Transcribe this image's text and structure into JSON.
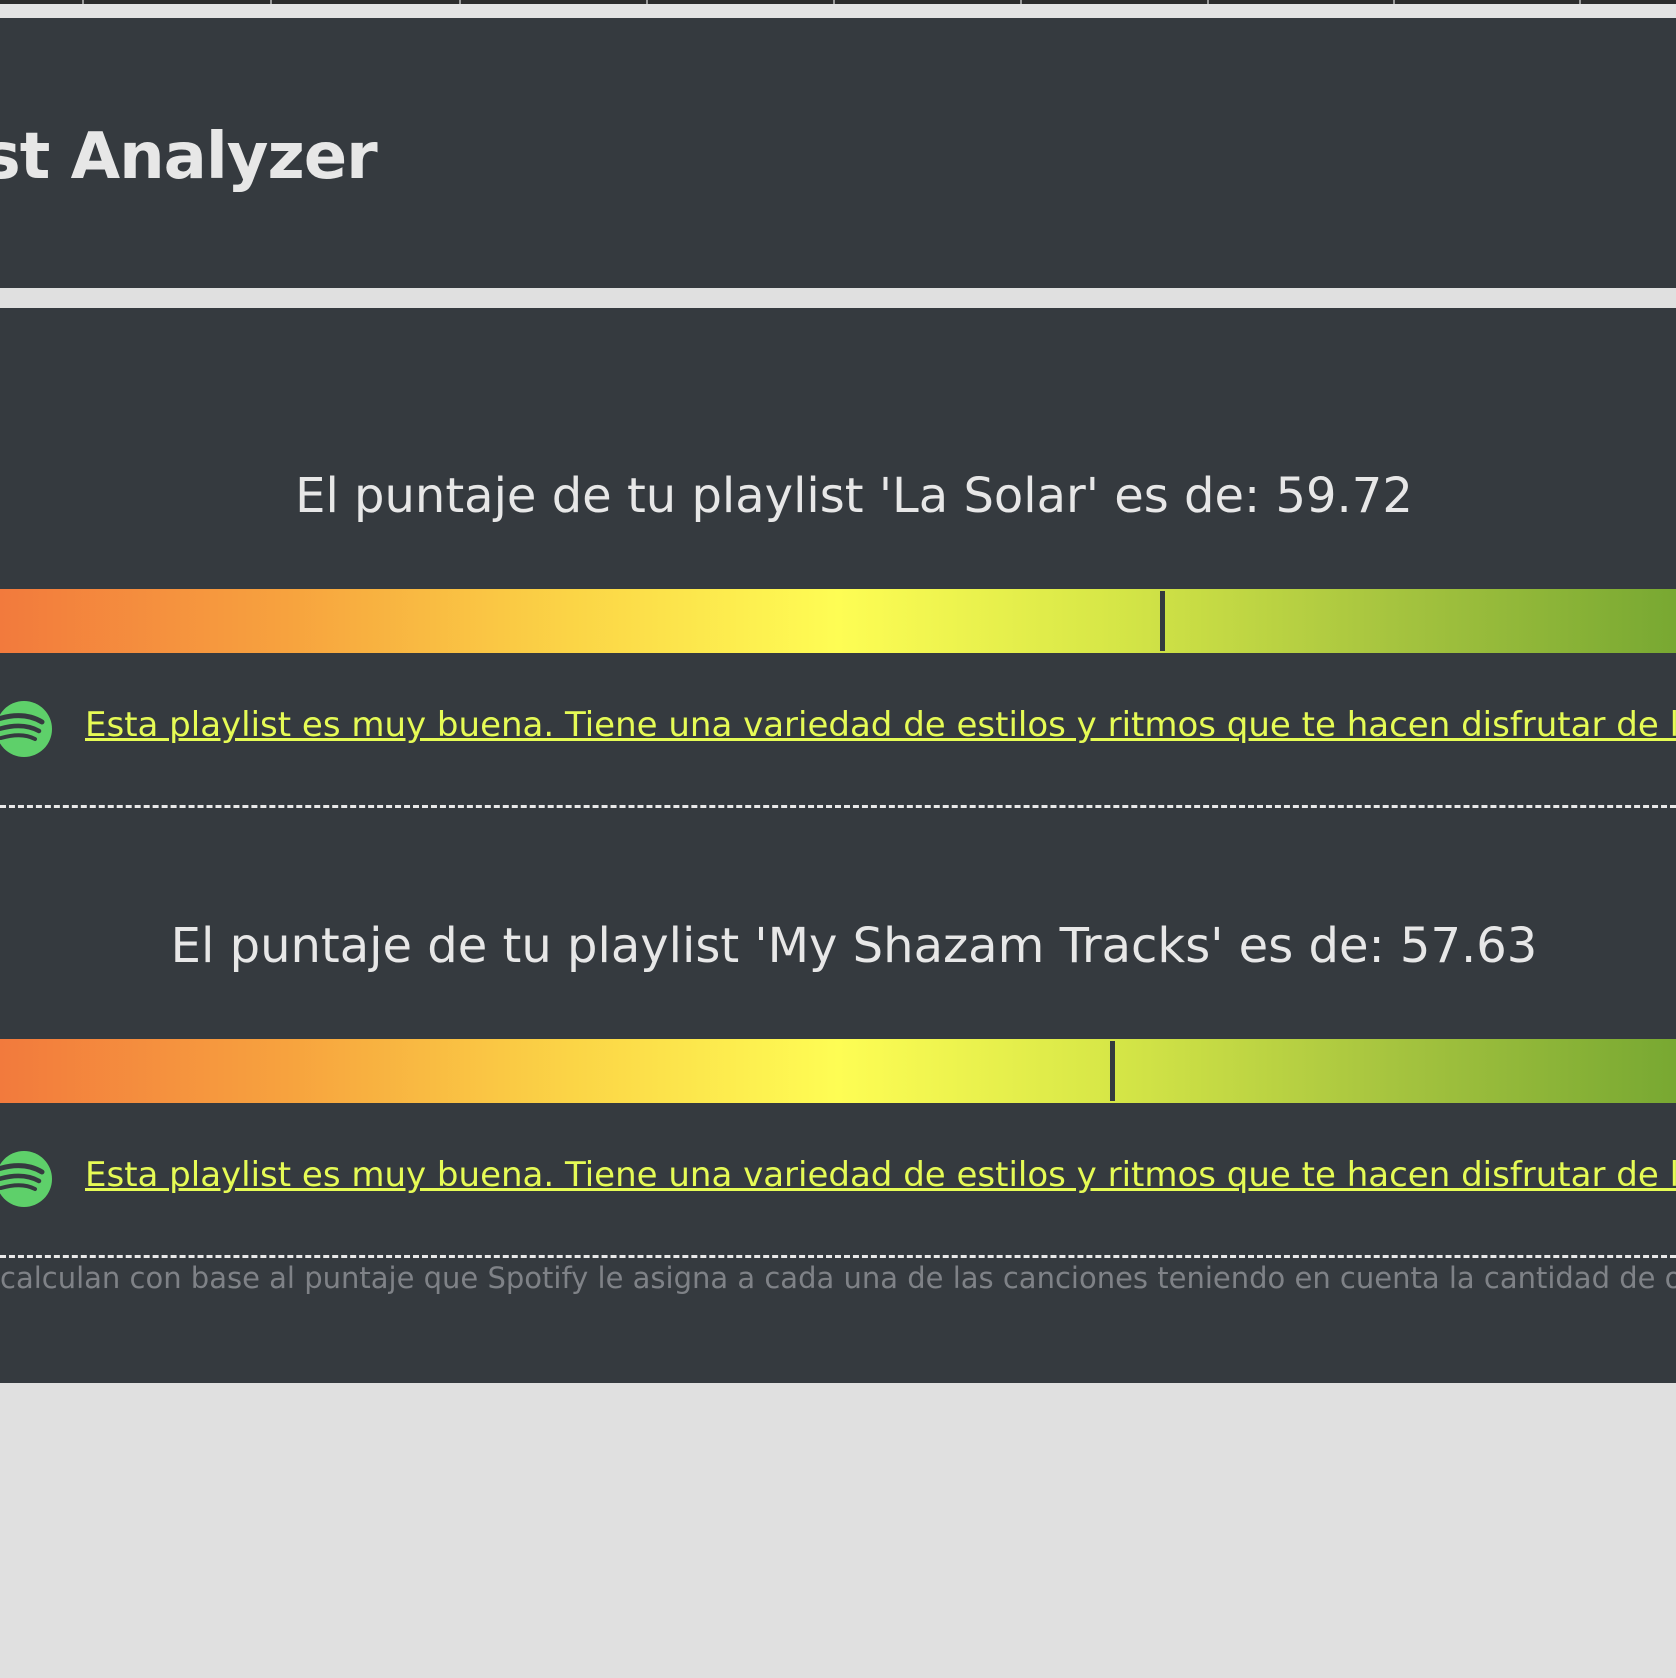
{
  "header": {
    "title": "ylist Analyzer"
  },
  "results": [
    {
      "score_text": "El puntaje de tu playlist 'La Solar' es de: 59.72",
      "score_value": 59.72,
      "description": "Esta playlist es muy buena. Tiene una variedad de estilos y ritmos que te hacen disfrutar de la músic",
      "icon": "spotify-icon"
    },
    {
      "score_text": "El puntaje de tu playlist 'My Shazam Tracks' es de: 57.63",
      "score_value": 57.63,
      "description": "Esta playlist es muy buena. Tiene una variedad de estilos y ritmos que te hacen disfrutar de la músic",
      "icon": "spotify-icon"
    }
  ],
  "footnote": "calculan con base al puntaje que Spotify le asigna a cada una de las canciones teniendo en cuenta la cantidad de oyen",
  "colors": {
    "panel": "#353a3f",
    "page_background": "#e0e0e0",
    "text": "#e7e7e7",
    "link": "#e6fb55",
    "spotify_green": "#5ed06a",
    "gradient": [
      "#f27a3d",
      "#fbd446",
      "#fefd54",
      "#78a832"
    ]
  }
}
